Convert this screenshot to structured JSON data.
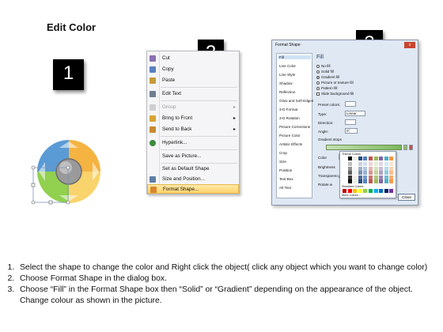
{
  "heading": "Edit Color",
  "steps": [
    "1",
    "2",
    "3"
  ],
  "context_menu": {
    "items": [
      {
        "label": "Cut",
        "icon": "scissors-icon",
        "color": "#8a6fb4",
        "disabled": false,
        "submenu": false
      },
      {
        "label": "Copy",
        "icon": "copy-icon",
        "color": "#5a7fc0",
        "disabled": false,
        "submenu": false
      },
      {
        "label": "Paste",
        "icon": "paste-icon",
        "color": "#c79a3a",
        "disabled": false,
        "submenu": false
      },
      {
        "label": "Edit Text",
        "icon": "edit-text-icon",
        "color": "#6f7f90",
        "disabled": false,
        "submenu": false
      },
      {
        "label": "Group",
        "icon": "group-icon",
        "color": "#b0b0b0",
        "disabled": true,
        "submenu": true
      },
      {
        "label": "Bring to Front",
        "icon": "bring-front-icon",
        "color": "#d6a436",
        "disabled": false,
        "submenu": true
      },
      {
        "label": "Send to Back",
        "icon": "send-back-icon",
        "color": "#c98a2e",
        "disabled": false,
        "submenu": true
      },
      {
        "label": "Hyperlink...",
        "icon": "hyperlink-icon",
        "color": "#3d8b3d",
        "disabled": false,
        "submenu": false
      },
      {
        "label": "Save as Picture...",
        "icon": "",
        "color": "",
        "disabled": false,
        "submenu": false
      },
      {
        "label": "Set as Default Shape",
        "icon": "",
        "color": "",
        "disabled": false,
        "submenu": false
      },
      {
        "label": "Size and Position...",
        "icon": "size-position-icon",
        "color": "#5f7fa8",
        "disabled": false,
        "submenu": false
      },
      {
        "label": "Format Shape...",
        "icon": "format-shape-icon",
        "color": "#d9862e",
        "disabled": false,
        "submenu": false,
        "highlighted": true
      }
    ]
  },
  "dialog": {
    "title": "Format Shape",
    "close": "x",
    "categories": [
      "Fill",
      "Line Color",
      "Line Style",
      "Shadow",
      "Reflection",
      "Glow and Soft Edges",
      "3-D Format",
      "3-D Rotation",
      "Picture Corrections",
      "Picture Color",
      "Artistic Effects",
      "Crop",
      "Size",
      "Position",
      "Text Box",
      "Alt Text"
    ],
    "fill_heading": "Fill",
    "fill_options": [
      "No fill",
      "Solid fill",
      "Gradient fill",
      "Picture or texture fill",
      "Pattern fill",
      "Slide background fill"
    ],
    "selected_fill": "Gradient fill",
    "labels": {
      "preset": "Preset colors:",
      "type": "Type:",
      "type_value": "Linear",
      "direction": "Direction:",
      "angle": "Angle:",
      "angle_value": "0°",
      "stops": "Gradient stops",
      "color": "Color",
      "position": "Position:",
      "position_value": "0%",
      "brightness": "Brightness",
      "transparency": "Transparency",
      "rotate": "Rotate w"
    },
    "palette": {
      "theme_label": "Theme Colors",
      "standard_label": "Standard Colors",
      "more_label": "More Colors...",
      "theme_colors": [
        "#ffffff",
        "#000000",
        "#eeece1",
        "#1f497d",
        "#4f81bd",
        "#c0504d",
        "#9bbb59",
        "#8064a2",
        "#4bacc6",
        "#f79646"
      ],
      "standard_colors": [
        "#c00000",
        "#ff0000",
        "#ffc000",
        "#ffff00",
        "#92d050",
        "#00b050",
        "#00b0f0",
        "#0070c0",
        "#002060",
        "#7030a0"
      ]
    },
    "close_button": "Close"
  },
  "instructions": [
    "Select the shape to change the color and Right click the object( click any object which you want to change color)",
    "Choose Format Shape in the dialog box.",
    "Choose “Fill” in the Format Shape box then “Solid” or “Gradient” depending on the appearance of the object. Change colour as shown in the picture."
  ],
  "colors": {
    "blue": "#5b9bd5",
    "orange": "#f5b342",
    "yellow": "#f9d36b",
    "green": "#92d050",
    "gray": "#8c8c8c"
  }
}
